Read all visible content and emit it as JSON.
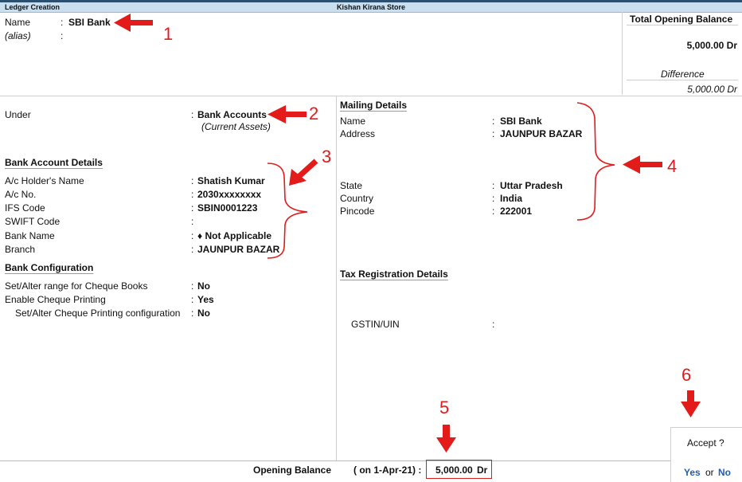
{
  "titlebar": {
    "screen": "Ledger Creation",
    "company": "Kishan Kirana Store"
  },
  "header": {
    "name_label": "Name",
    "name_colon": ":",
    "name_value": "SBI Bank",
    "alias_label": "(alias)",
    "alias_colon": ":"
  },
  "balance_panel": {
    "title": "Total Opening Balance",
    "amount": "5,000.00 Dr",
    "difference_label": "Difference",
    "difference_value": "5,000.00 Dr"
  },
  "left": {
    "under_label": "Under",
    "under_colon": ":",
    "under_value": "Bank Accounts",
    "under_sub": "(Current Assets)",
    "bank_details_heading": "Bank Account Details",
    "bank_fields": [
      {
        "label": "A/c Holder's Name",
        "colon": ":",
        "value": "Shatish Kumar"
      },
      {
        "label": "A/c No.",
        "colon": ":",
        "value": "2030xxxxxxxx"
      },
      {
        "label": "IFS Code",
        "colon": ":",
        "value": "SBIN0001223"
      },
      {
        "label": "SWIFT Code",
        "colon": ":",
        "value": ""
      },
      {
        "label": "Bank Name",
        "colon": ":",
        "value": "♦ Not Applicable"
      },
      {
        "label": "Branch",
        "colon": ":",
        "value": "JAUNPUR BAZAR"
      }
    ],
    "bank_config_heading": "Bank Configuration",
    "config_fields": [
      {
        "label": "Set/Alter range for Cheque Books",
        "colon": ":",
        "value": "No"
      },
      {
        "label": "Enable Cheque Printing",
        "colon": ":",
        "value": "Yes"
      },
      {
        "label": "Set/Alter Cheque Printing configuration",
        "colon": ":",
        "value": "No"
      }
    ]
  },
  "right": {
    "mailing_heading": "Mailing Details",
    "mailing_fields": [
      {
        "label": "Name",
        "colon": ":",
        "value": "SBI Bank"
      },
      {
        "label": "Address",
        "colon": ":",
        "value": "JAUNPUR BAZAR"
      },
      {
        "label": "State",
        "colon": ":",
        "value": "Uttar Pradesh"
      },
      {
        "label": "Country",
        "colon": ":",
        "value": "India"
      },
      {
        "label": "Pincode",
        "colon": ":",
        "value": "222001"
      }
    ],
    "tax_heading": "Tax Registration Details",
    "gstin_label": "GSTIN/UIN",
    "gstin_colon": ":"
  },
  "footer": {
    "label": "Opening Balance",
    "date": "( on 1-Apr-21)  :",
    "amount": "5,000.00",
    "dr": "Dr"
  },
  "accept": {
    "question": "Accept ?",
    "yes": "Yes",
    "or": "or",
    "no": "No"
  },
  "annotations": {
    "n1": "1",
    "n2": "2",
    "n3": "3",
    "n4": "4",
    "n5": "5",
    "n6": "6",
    "color": "#e31b1b"
  }
}
